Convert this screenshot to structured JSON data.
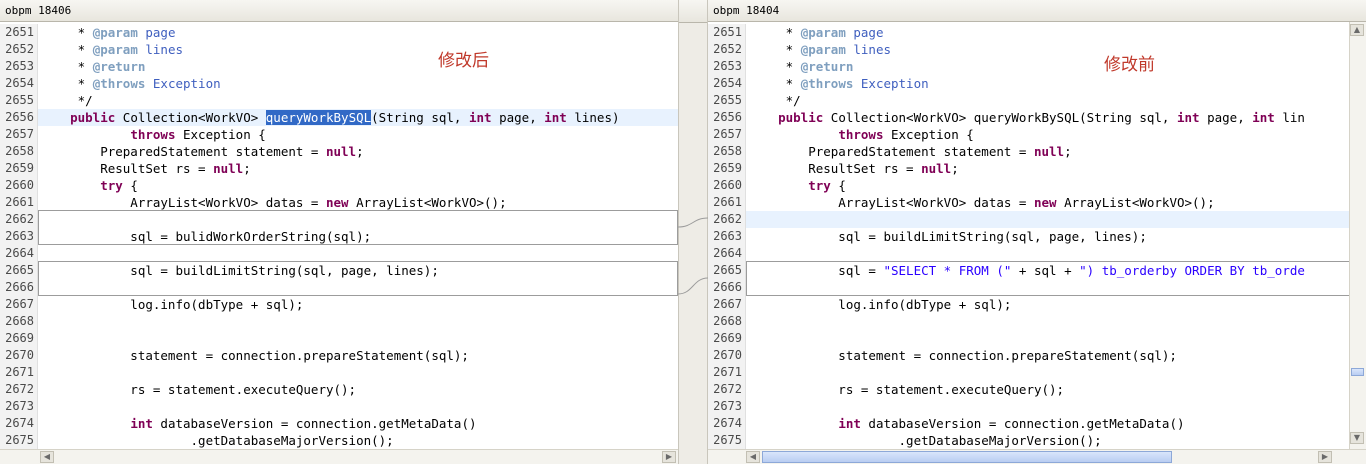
{
  "left": {
    "title": "obpm 18406",
    "annotation": "修改后"
  },
  "right": {
    "title": "obpm 18404",
    "annotation": "修改前"
  },
  "line_numbers": [
    "2651",
    "2652",
    "2653",
    "2654",
    "2655",
    "2656",
    "2657",
    "2658",
    "2659",
    "2660",
    "2661",
    "2662",
    "2663",
    "2664",
    "2665",
    "2666",
    "2667",
    "2668",
    "2669",
    "2670",
    "2671",
    "2672",
    "2673",
    "2674",
    "2675"
  ],
  "left_code": [
    [
      {
        "t": "     * "
      },
      {
        "t": "@param",
        "c": "tag"
      },
      {
        "t": " page",
        "c": "cm"
      }
    ],
    [
      {
        "t": "     * "
      },
      {
        "t": "@param",
        "c": "tag"
      },
      {
        "t": " lines",
        "c": "cm"
      }
    ],
    [
      {
        "t": "     * "
      },
      {
        "t": "@return",
        "c": "tag"
      }
    ],
    [
      {
        "t": "     * "
      },
      {
        "t": "@throws",
        "c": "tag"
      },
      {
        "t": " Exception",
        "c": "cm"
      }
    ],
    [
      {
        "t": "     */"
      }
    ],
    [
      {
        "t": "    "
      },
      {
        "t": "public",
        "c": "kw"
      },
      {
        "t": " Collection<WorkVO> "
      },
      {
        "t": "queryWorkBySQL",
        "c": "sel"
      },
      {
        "t": "(String sql, "
      },
      {
        "t": "int",
        "c": "kw"
      },
      {
        "t": " page, "
      },
      {
        "t": "int",
        "c": "kw"
      },
      {
        "t": " lines)"
      }
    ],
    [
      {
        "t": "            "
      },
      {
        "t": "throws",
        "c": "kw"
      },
      {
        "t": " Exception {"
      }
    ],
    [
      {
        "t": "        PreparedStatement statement = "
      },
      {
        "t": "null",
        "c": "kw"
      },
      {
        "t": ";"
      }
    ],
    [
      {
        "t": "        ResultSet rs = "
      },
      {
        "t": "null",
        "c": "kw"
      },
      {
        "t": ";"
      }
    ],
    [
      {
        "t": "        "
      },
      {
        "t": "try",
        "c": "kw"
      },
      {
        "t": " {"
      }
    ],
    [
      {
        "t": "            ArrayList<WorkVO> datas = "
      },
      {
        "t": "new",
        "c": "kw"
      },
      {
        "t": " ArrayList<WorkVO>();"
      }
    ],
    [
      {
        "t": ""
      }
    ],
    [
      {
        "t": "            sql = bulidWorkOrderString(sql);"
      }
    ],
    [
      {
        "t": ""
      }
    ],
    [
      {
        "t": "            sql = buildLimitString(sql, page, lines);"
      }
    ],
    [
      {
        "t": ""
      }
    ],
    [
      {
        "t": "            log.info(dbType + sql);"
      }
    ],
    [
      {
        "t": ""
      }
    ],
    [
      {
        "t": ""
      }
    ],
    [
      {
        "t": "            statement = connection.prepareStatement(sql);"
      }
    ],
    [
      {
        "t": ""
      }
    ],
    [
      {
        "t": "            rs = statement.executeQuery();"
      }
    ],
    [
      {
        "t": ""
      }
    ],
    [
      {
        "t": "            "
      },
      {
        "t": "int",
        "c": "kw"
      },
      {
        "t": " databaseVersion = connection.getMetaData()"
      }
    ],
    [
      {
        "t": "                    .getDatabaseMajorVersion();"
      }
    ]
  ],
  "right_code": [
    [
      {
        "t": "     * "
      },
      {
        "t": "@param",
        "c": "tag"
      },
      {
        "t": " page",
        "c": "cm"
      }
    ],
    [
      {
        "t": "     * "
      },
      {
        "t": "@param",
        "c": "tag"
      },
      {
        "t": " lines",
        "c": "cm"
      }
    ],
    [
      {
        "t": "     * "
      },
      {
        "t": "@return",
        "c": "tag"
      }
    ],
    [
      {
        "t": "     * "
      },
      {
        "t": "@throws",
        "c": "tag"
      },
      {
        "t": " Exception",
        "c": "cm"
      }
    ],
    [
      {
        "t": "     */"
      }
    ],
    [
      {
        "t": "    "
      },
      {
        "t": "public",
        "c": "kw"
      },
      {
        "t": " Collection<WorkVO> queryWorkBySQL(String sql, "
      },
      {
        "t": "int",
        "c": "kw"
      },
      {
        "t": " page, "
      },
      {
        "t": "int",
        "c": "kw"
      },
      {
        "t": " lin"
      }
    ],
    [
      {
        "t": "            "
      },
      {
        "t": "throws",
        "c": "kw"
      },
      {
        "t": " Exception {"
      }
    ],
    [
      {
        "t": "        PreparedStatement statement = "
      },
      {
        "t": "null",
        "c": "kw"
      },
      {
        "t": ";"
      }
    ],
    [
      {
        "t": "        ResultSet rs = "
      },
      {
        "t": "null",
        "c": "kw"
      },
      {
        "t": ";"
      }
    ],
    [
      {
        "t": "        "
      },
      {
        "t": "try",
        "c": "kw"
      },
      {
        "t": " {"
      }
    ],
    [
      {
        "t": "            ArrayList<WorkVO> datas = "
      },
      {
        "t": "new",
        "c": "kw"
      },
      {
        "t": " ArrayList<WorkVO>();"
      }
    ],
    [
      {
        "t": ""
      }
    ],
    [
      {
        "t": "            sql = buildLimitString(sql, page, lines);"
      }
    ],
    [
      {
        "t": ""
      }
    ],
    [
      {
        "t": "            sql = "
      },
      {
        "t": "\"SELECT * FROM (\"",
        "c": "str"
      },
      {
        "t": " + sql + "
      },
      {
        "t": "\") tb_orderby ORDER BY tb_orde",
        "c": "str"
      }
    ],
    [
      {
        "t": ""
      }
    ],
    [
      {
        "t": "            log.info(dbType + sql);"
      }
    ],
    [
      {
        "t": ""
      }
    ],
    [
      {
        "t": ""
      }
    ],
    [
      {
        "t": "            statement = connection.prepareStatement(sql);"
      }
    ],
    [
      {
        "t": ""
      }
    ],
    [
      {
        "t": "            rs = statement.executeQuery();"
      }
    ],
    [
      {
        "t": ""
      }
    ],
    [
      {
        "t": "            "
      },
      {
        "t": "int",
        "c": "kw"
      },
      {
        "t": " databaseVersion = connection.getMetaData()"
      }
    ],
    [
      {
        "t": "                    .getDatabaseMajorVersion();"
      }
    ]
  ],
  "scroll": {
    "left_arrow": "◀",
    "right_arrow": "▶",
    "up_arrow": "▲",
    "down_arrow": "▼"
  }
}
